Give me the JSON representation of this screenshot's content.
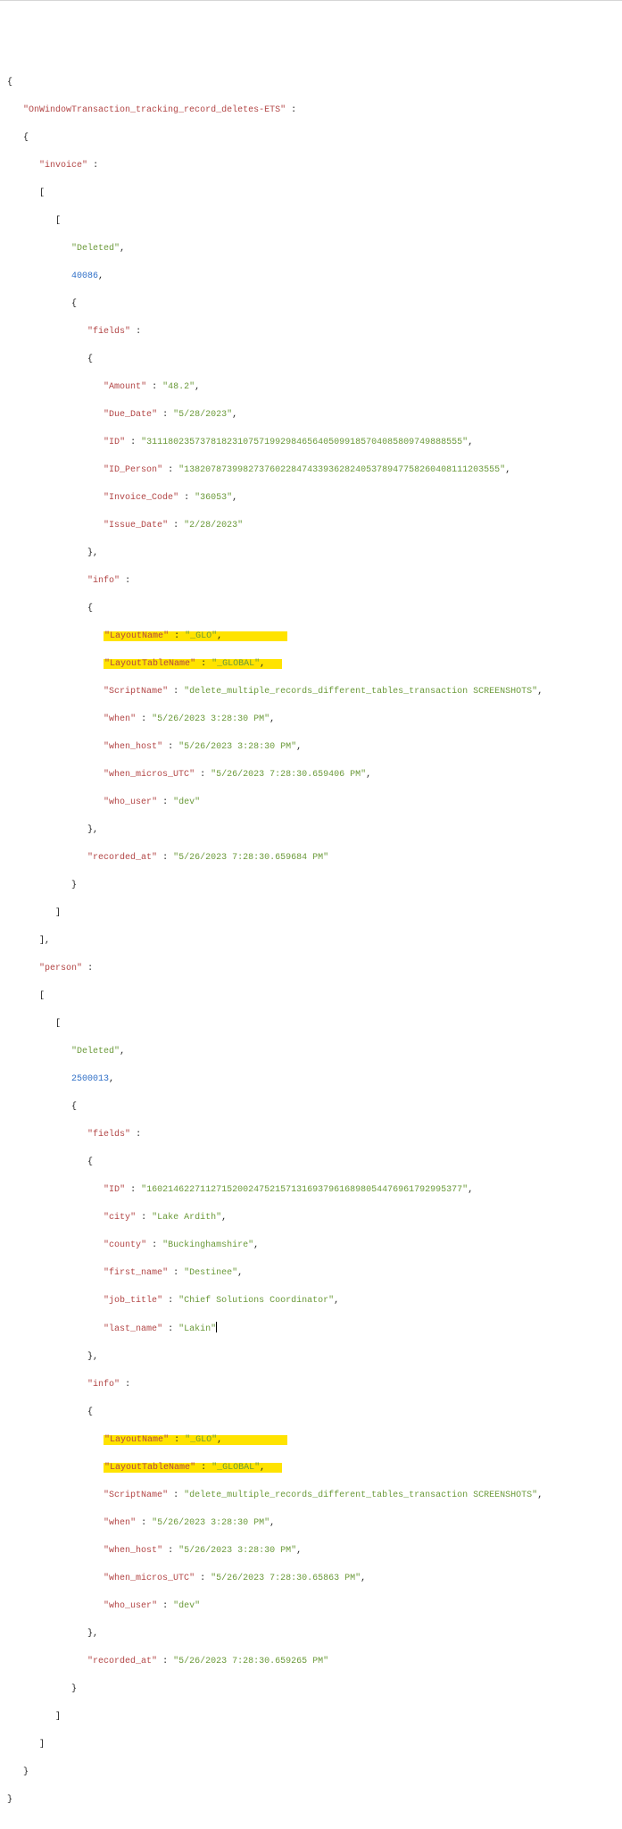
{
  "keys": {
    "root": "OnWindowTransaction_tracking_record_deletes-ETS",
    "invoice": "invoice",
    "person": "person",
    "deleted": "Deleted",
    "fields": "fields",
    "info": "info",
    "recorded_at": "recorded_at",
    "amount": "Amount",
    "due_date": "Due_Date",
    "id": "ID",
    "id_person": "ID_Person",
    "invoice_code": "Invoice_Code",
    "issue_date": "Issue_Date",
    "layout_name": "LayoutName",
    "layout_table_name": "LayoutTableName",
    "script_name": "ScriptName",
    "when": "when",
    "when_host": "when_host",
    "when_micros_utc": "when_micros_UTC",
    "who_user": "who_user",
    "city": "city",
    "county": "county",
    "first_name": "first_name",
    "job_title": "job_title",
    "last_name": "last_name"
  },
  "vals": {
    "inv_id": "40086",
    "amount": "48.2",
    "due_date": "5/28/2023",
    "id_inv": "31118023573781823107571992984656405099185704085809749888555",
    "id_person_inv": "13820787399827376022847433936282405378947758260408111203555",
    "invoice_code": "36053",
    "issue_date": "2/28/2023",
    "layout_name": "_GLO",
    "layout_table_name": "_GLOBAL",
    "script_name": "delete_multiple_records_different_tables_transaction SCREENSHOTS",
    "when": "5/26/2023 3:28:30 PM",
    "when_host": "5/26/2023 3:28:30 PM",
    "when_micros_utc_inv": "5/26/2023 7:28:30.659406 PM",
    "who_user": "dev",
    "recorded_at_inv": "5/26/2023 7:28:30.659684 PM",
    "per_id": "2500013",
    "id_per": "16021462271127152002475215713169379616898054476961792995377",
    "city": "Lake Ardith",
    "county": "Buckinghamshire",
    "first_name": "Destinee",
    "job_title": "Chief Solutions Coordinator",
    "last_name": "Lakin",
    "when_micros_utc_per": "5/26/2023 7:28:30.65863 PM",
    "recorded_at_per": "5/26/2023 7:28:30.659265 PM"
  }
}
